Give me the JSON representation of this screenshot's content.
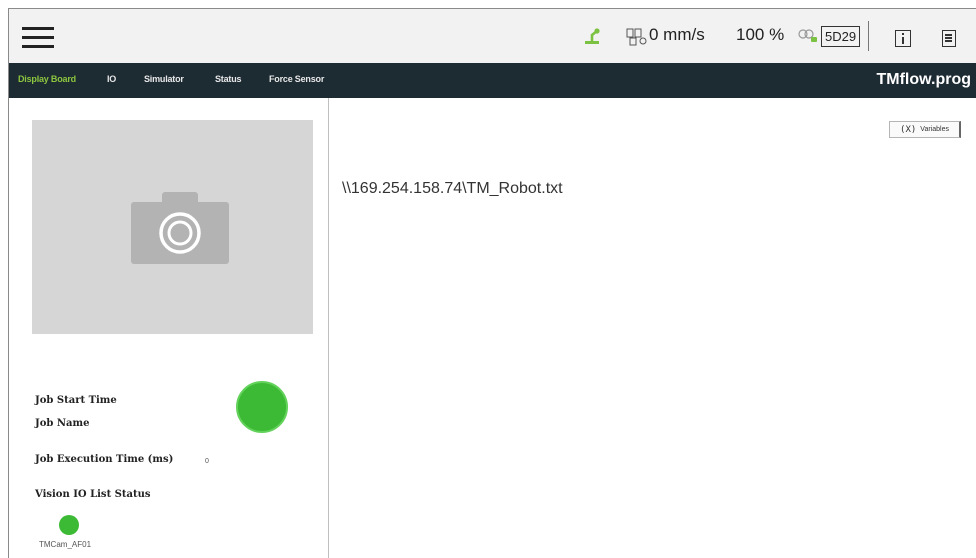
{
  "toolbar": {
    "speed": "0 mm/s",
    "speed_percent": "100 %",
    "controller_code": "5D29"
  },
  "nav": {
    "tabs": [
      {
        "label": "Display Board",
        "active": true
      },
      {
        "label": "IO",
        "active": false
      },
      {
        "label": "Simulator",
        "active": false
      },
      {
        "label": "Status",
        "active": false
      },
      {
        "label": "Force Sensor",
        "active": false
      }
    ],
    "project_title": "TMflow.prog"
  },
  "left_panel": {
    "camera_placeholder_icon": "camera-icon",
    "job_start_time_label": "Job Start Time",
    "job_name_label": "Job Name",
    "job_execution_time_label": "Job Execution Time (ms)",
    "job_execution_time_value": "0",
    "vision_io_list_status_label": "Vision IO List Status",
    "vision_io_items": [
      {
        "label": "TMCam_AF01",
        "status_color": "#3dba35"
      }
    ],
    "job_status_color": "#3dba35"
  },
  "main": {
    "variables_button": {
      "icon": "(X)",
      "label": "Variables"
    },
    "display_text": "\\\\169.254.158.74\\TM_Robot.txt"
  },
  "colors": {
    "nav_background": "#1d2b33",
    "active_tab": "#8cc63f",
    "status_green": "#3dba35",
    "toolbar_background": "#f2f2f2"
  }
}
